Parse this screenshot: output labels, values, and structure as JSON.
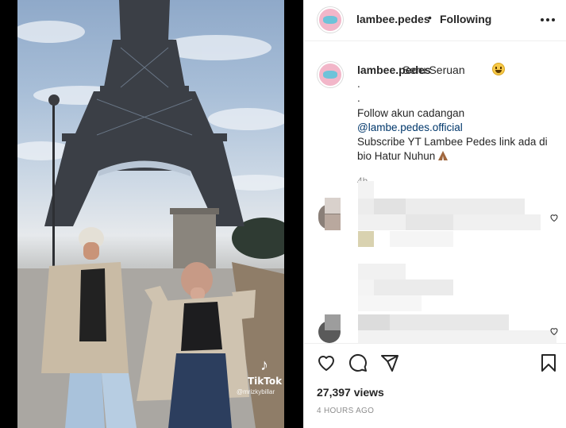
{
  "post": {
    "username": "lambee.pedes",
    "separator": "•",
    "follow_status": "Following",
    "caption": {
      "username": "lambee.pedes",
      "text": "Seru Seruan",
      "lines": [
        ".",
        ".",
        "Follow akun cadangan",
        "@lambe.pedes.official",
        "Subscribe YT Lambee Pedes link ada di",
        "bio Hatur Nuhun"
      ],
      "time": "4h"
    },
    "views": "27,397 views",
    "posted_ago": "4 HOURS AGO"
  },
  "video_overlay": {
    "brand": "TikTok",
    "handle": "@mrizkybillar"
  },
  "icons": {
    "more": "more-options-icon",
    "like": "heart-icon",
    "comment": "comment-icon",
    "share": "share-icon",
    "save": "bookmark-icon"
  },
  "colors": {
    "text": "#262626",
    "secondary": "#8e8e8e",
    "link": "#00376b",
    "border": "#efefef"
  }
}
